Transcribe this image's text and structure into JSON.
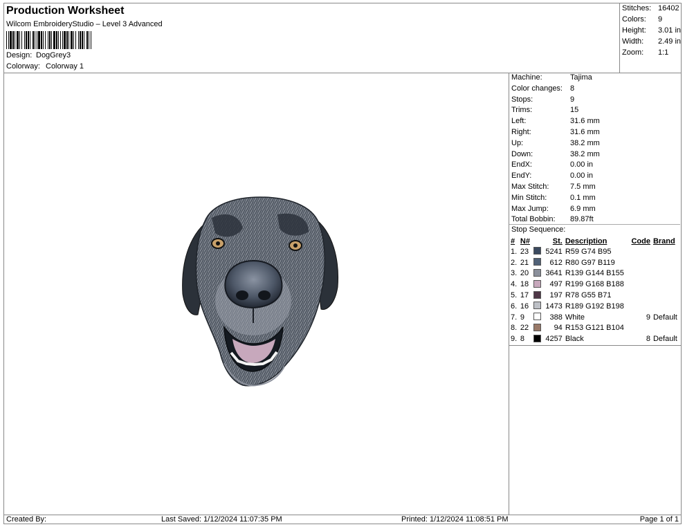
{
  "header": {
    "title": "Production Worksheet",
    "software": "Wilcom EmbroideryStudio – Level 3 Advanced",
    "design_label": "Design:",
    "design_value": "DogGrey3",
    "colorway_label": "Colorway:",
    "colorway_value": "Colorway 1"
  },
  "summary": {
    "stitches_label": "Stitches:",
    "stitches": "16402",
    "colors_label": "Colors:",
    "colors": "9",
    "height_label": "Height:",
    "height": "3.01 in",
    "width_label": "Width:",
    "width": "2.49 in",
    "zoom_label": "Zoom:",
    "zoom": "1:1"
  },
  "machine_info": [
    {
      "label": "Machine:",
      "value": "Tajima"
    },
    {
      "label": "Color changes:",
      "value": "8"
    },
    {
      "label": "Stops:",
      "value": "9"
    },
    {
      "label": "Trims:",
      "value": "15"
    },
    {
      "label": "Left:",
      "value": "31.6 mm"
    },
    {
      "label": "Right:",
      "value": "31.6 mm"
    },
    {
      "label": "Up:",
      "value": "38.2 mm"
    },
    {
      "label": "Down:",
      "value": "38.2 mm"
    },
    {
      "label": "EndX:",
      "value": "0.00 in"
    },
    {
      "label": "EndY:",
      "value": "0.00 in"
    },
    {
      "label": "Max Stitch:",
      "value": "7.5 mm"
    },
    {
      "label": "Min Stitch:",
      "value": "0.1 mm"
    },
    {
      "label": "Max Jump:",
      "value": "6.9 mm"
    },
    {
      "label": "Total Bobbin:",
      "value": "89.87ft"
    }
  ],
  "stop_sequence": {
    "title": "Stop Sequence:",
    "headers": {
      "num": "#",
      "needle": "N#",
      "stitches": "St.",
      "description": "Description",
      "code": "Code",
      "brand": "Brand"
    },
    "rows": [
      {
        "num": "1.",
        "needle": "23",
        "color": "#3b4a5f",
        "stitches": "5241",
        "description": "R59 G74 B95",
        "code": "",
        "brand": ""
      },
      {
        "num": "2.",
        "needle": "21",
        "color": "#506177",
        "stitches": "612",
        "description": "R80 G97 B119",
        "code": "",
        "brand": ""
      },
      {
        "num": "3.",
        "needle": "20",
        "color": "#8b909b",
        "stitches": "3641",
        "description": "R139 G144 B155",
        "code": "",
        "brand": ""
      },
      {
        "num": "4.",
        "needle": "18",
        "color": "#c7a8bc",
        "stitches": "497",
        "description": "R199 G168 B188",
        "code": "",
        "brand": ""
      },
      {
        "num": "5.",
        "needle": "17",
        "color": "#4e3747",
        "stitches": "197",
        "description": "R78 G55 B71",
        "code": "",
        "brand": ""
      },
      {
        "num": "6.",
        "needle": "16",
        "color": "#bdc0c6",
        "stitches": "1473",
        "description": "R189 G192 B198",
        "code": "",
        "brand": ""
      },
      {
        "num": "7.",
        "needle": "9",
        "color": "#ffffff",
        "stitches": "388",
        "description": "White",
        "code": "9",
        "brand": "Default"
      },
      {
        "num": "8.",
        "needle": "22",
        "color": "#997968",
        "stitches": "94",
        "description": "R153 G121 B104",
        "code": "",
        "brand": ""
      },
      {
        "num": "9.",
        "needle": "8",
        "color": "#000000",
        "stitches": "4257",
        "description": "Black",
        "code": "8",
        "brand": "Default"
      }
    ]
  },
  "footer": {
    "created_by": "Created By:",
    "last_saved": "Last Saved: 1/12/2024 11:07:35 PM",
    "printed": "Printed: 1/12/2024 11:08:51 PM",
    "page": "Page 1 of 1"
  }
}
